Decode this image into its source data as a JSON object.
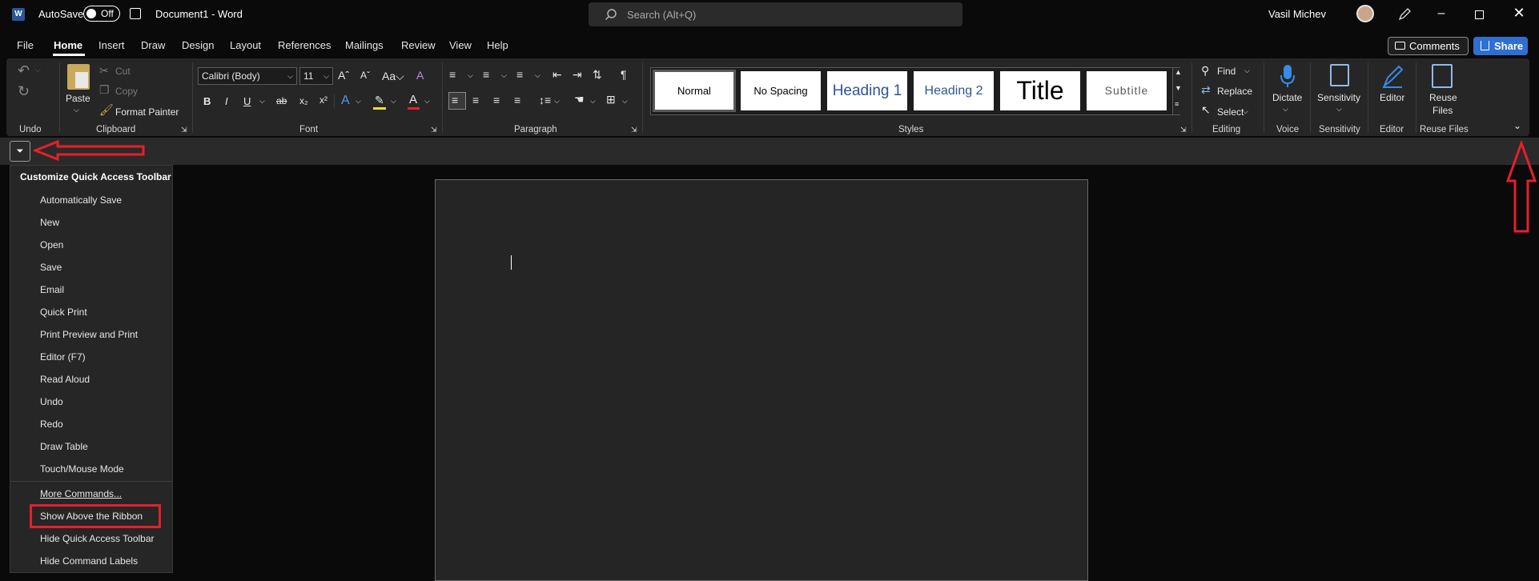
{
  "titlebar": {
    "autosave_label": "AutoSave",
    "autosave_state": "Off",
    "document_title": "Document1  -  Word",
    "search_placeholder": "Search (Alt+Q)",
    "user_name": "Vasil Michev"
  },
  "tabs": [
    "File",
    "Home",
    "Insert",
    "Draw",
    "Design",
    "Layout",
    "References",
    "Mailings",
    "Review",
    "View",
    "Help"
  ],
  "active_tab": "Home",
  "header_buttons": {
    "comments": "Comments",
    "share": "Share"
  },
  "ribbon": {
    "groups": {
      "undo": "Undo",
      "clipboard": "Clipboard",
      "font": "Font",
      "paragraph": "Paragraph",
      "styles": "Styles",
      "editing": "Editing",
      "voice": "Voice",
      "sensitivity": "Sensitivity",
      "editor": "Editor",
      "reuse_files": "Reuse Files"
    },
    "clipboard": {
      "paste": "Paste",
      "cut": "Cut",
      "copy": "Copy",
      "format_painter": "Format Painter"
    },
    "font": {
      "name": "Calibri (Body)",
      "size": "11"
    },
    "styles": [
      "Normal",
      "No Spacing",
      "Heading 1",
      "Heading 2",
      "Title",
      "Subtitle"
    ],
    "editing": {
      "find": "Find",
      "replace": "Replace",
      "select": "Select"
    },
    "voice": {
      "dictate": "Dictate"
    },
    "sensitivity": {
      "label": "Sensitivity"
    },
    "editor": {
      "label": "Editor"
    },
    "reuse": {
      "label_line1": "Reuse",
      "label_line2": "Files"
    }
  },
  "qat_menu": {
    "title": "Customize Quick Access Toolbar",
    "items": [
      "Automatically Save",
      "New",
      "Open",
      "Save",
      "Email",
      "Quick Print",
      "Print Preview and Print",
      "Editor (F7)",
      "Read Aloud",
      "Undo",
      "Redo",
      "Draw Table",
      "Touch/Mouse Mode"
    ],
    "more_commands": "More Commands...",
    "show_above": "Show Above the Ribbon",
    "hide_toolbar": "Hide Quick Access Toolbar",
    "hide_labels": "Hide Command Labels"
  },
  "colors": {
    "accent_share": "#2f6fd1",
    "annotation_red": "#e4202b",
    "heading_blue": "#2f5496"
  }
}
